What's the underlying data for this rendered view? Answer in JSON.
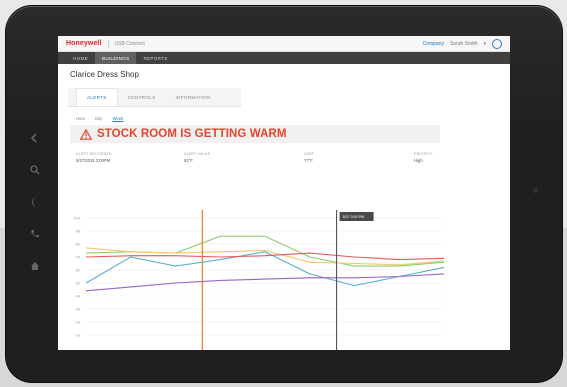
{
  "app": {
    "logo_text": "Honeywell",
    "account_text": "USB Connect",
    "top_link": "Company",
    "user_name": "Sarah Smith"
  },
  "nav": {
    "items": [
      {
        "label": "HOME",
        "active": false
      },
      {
        "label": "BUILDINGS",
        "active": true
      },
      {
        "label": "REPORTS",
        "active": false
      }
    ]
  },
  "page": {
    "title": "Clarice Dress Shop"
  },
  "subtabs": [
    {
      "label": "ALERTS",
      "active": true
    },
    {
      "label": "CONTROLS",
      "active": false
    },
    {
      "label": "INFORMATION",
      "active": false
    }
  ],
  "range_options": [
    {
      "label": "Hour",
      "active": false
    },
    {
      "label": "Day",
      "active": false
    },
    {
      "label": "Week",
      "active": true
    }
  ],
  "alert": {
    "message": "STOCK ROOM IS GETTING WARM",
    "color": "#e4452a"
  },
  "stats": [
    {
      "label": "ALERT RECORDED",
      "value": "5/27/2015 3:00PM"
    },
    {
      "label": "ALERT VALUE",
      "value": "82°F"
    },
    {
      "label": "LIMIT",
      "value": "77°F"
    },
    {
      "label": "PRIORITY",
      "value": "High"
    }
  ],
  "chart_data": {
    "type": "line",
    "title": "",
    "xlabel": "",
    "ylabel": "",
    "ylim": [
      0,
      100
    ],
    "yticks": [
      100,
      90,
      80,
      70,
      60,
      50,
      40,
      30,
      20,
      10
    ],
    "x": [
      0,
      1,
      2,
      3,
      4,
      5,
      6,
      7,
      8
    ],
    "marker_alert_x": 2.6,
    "marker_limit_x": 5.6,
    "marker_label": "5/27 3:00 PM",
    "series": [
      {
        "color": "#8ccf6a",
        "values": [
          73,
          74,
          73,
          86,
          86,
          70,
          63,
          63,
          66
        ]
      },
      {
        "color": "#f2c86c",
        "values": [
          77,
          74,
          73,
          74,
          75,
          66,
          65,
          64,
          67
        ]
      },
      {
        "color": "#5ab0cf",
        "values": [
          50,
          70,
          63,
          68,
          74,
          57,
          48,
          55,
          62
        ]
      },
      {
        "color": "#e85a5a",
        "values": [
          70,
          71,
          71,
          70,
          71,
          73,
          70,
          68,
          69
        ]
      },
      {
        "color": "#9a62c4",
        "values": [
          44,
          47,
          50,
          52,
          53,
          54,
          54,
          55,
          57
        ]
      }
    ],
    "colors": {
      "alert_marker": "#f07a2a",
      "limit_marker": "#444444",
      "grid": "#eeeeee"
    }
  }
}
